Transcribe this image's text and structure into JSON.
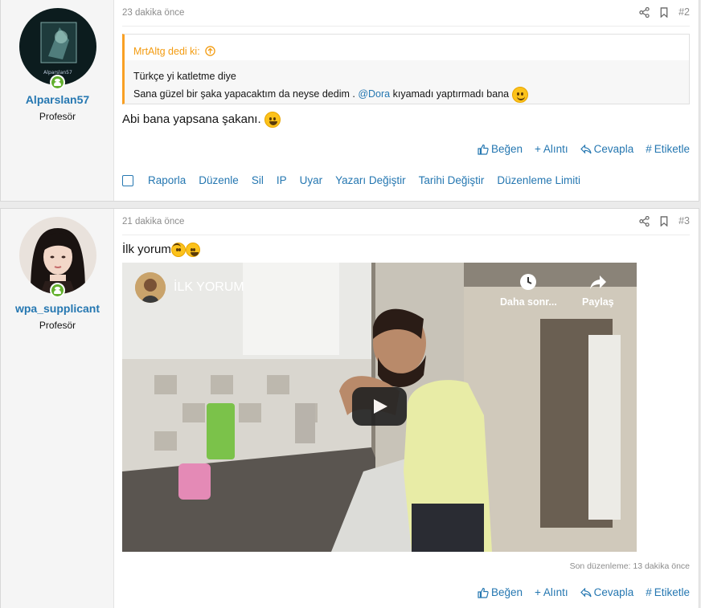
{
  "posts": [
    {
      "username": "Alparslan57",
      "avatar_text": "Alparslan57",
      "user_title": "Profesör",
      "time": "23 dakika önce",
      "number": "#2",
      "quote": {
        "author": "MrtAltg dedi ki:",
        "line1": "Türkçe yi katletme diye",
        "line2_before": "Sana güzel bir şaka yapacaktım da neyse dedim . ",
        "mention": "@Dora",
        "line2_after": " kıyamadı yaptırmadı bana"
      },
      "message": "Abi bana yapsana şakanı.",
      "actions": {
        "like": "Beğen",
        "quote": "Alıntı",
        "reply": "Cevapla",
        "tag": "Etiketle"
      },
      "mod_actions": [
        "Raporla",
        "Düzenle",
        "Sil",
        "IP",
        "Uyar",
        "Yazarı Değiştir",
        "Tarihi Değiştir",
        "Düzenleme Limiti"
      ]
    },
    {
      "username": "wpa_supplicant",
      "user_title": "Profesör",
      "time": "21 dakika önce",
      "number": "#3",
      "message": "İlk yorum",
      "video": {
        "title": "İLK YORUM",
        "watch_later": "Daha sonr...",
        "share": "Paylaş"
      },
      "edited": "Son düzenleme: 13 dakika önce",
      "actions": {
        "like": "Beğen",
        "quote": "Alıntı",
        "reply": "Cevapla",
        "tag": "Etiketle"
      }
    }
  ],
  "colors": {
    "link": "#2577b1",
    "quote_accent": "#f9a024",
    "online": "#63b02e"
  }
}
